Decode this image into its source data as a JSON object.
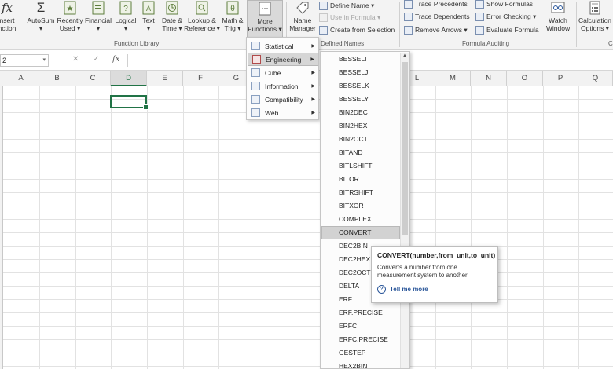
{
  "ribbon": {
    "buttons": [
      {
        "label1": "nsert",
        "label2": "nction",
        "icon": "fx-icon"
      },
      {
        "label1": "AutoSum",
        "label2": "▾",
        "icon": "sigma-icon"
      },
      {
        "label1": "Recently",
        "label2": "Used ▾",
        "icon": "star-icon"
      },
      {
        "label1": "Financial",
        "label2": "▾",
        "icon": "book-icon"
      },
      {
        "label1": "Logical",
        "label2": "▾",
        "icon": "question-book-icon"
      },
      {
        "label1": "Text",
        "label2": "▾",
        "icon": "text-book-icon"
      },
      {
        "label1": "Date &",
        "label2": "Time ▾",
        "icon": "clock-book-icon"
      },
      {
        "label1": "Lookup &",
        "label2": "Reference ▾",
        "icon": "magnifier-book-icon"
      },
      {
        "label1": "Math &",
        "label2": "Trig ▾",
        "icon": "math-book-icon"
      },
      {
        "label1": "More",
        "label2": "Functions ▾",
        "icon": "more-functions-icon"
      },
      {
        "label1": "Name",
        "label2": "Manager",
        "icon": "name-tag-icon"
      },
      {
        "label1": "Watch",
        "label2": "Window",
        "icon": "watch-window-icon"
      },
      {
        "label1": "Calculation",
        "label2": "Options ▾",
        "icon": "calculator-icon"
      }
    ],
    "defined_names": {
      "define_name": "Define Name ▾",
      "use_in_formula": "Use in Formula ▾",
      "create_from_selection": "Create from Selection"
    },
    "auditing": {
      "trace_precedents": "Trace Precedents",
      "trace_dependents": "Trace Dependents",
      "remove_arrows": "Remove Arrows ▾",
      "show_formulas": "Show Formulas",
      "error_checking": "Error Checking ▾",
      "evaluate_formula": "Evaluate Formula"
    },
    "groups": {
      "function_library": "Function Library",
      "defined_names": "Defined Names",
      "formula_auditing": "Formula Auditing",
      "calc": "C"
    }
  },
  "formula_bar": {
    "name_box": "2",
    "name_dropdown": "▾",
    "cancel": "✕",
    "enter": "✓",
    "fx": "fx"
  },
  "columns": [
    "A",
    "B",
    "C",
    "D",
    "E",
    "F",
    "G",
    "L",
    "M",
    "N",
    "O",
    "P",
    "Q"
  ],
  "more_functions_menu": [
    {
      "label": "Statistical",
      "accel": "S"
    },
    {
      "label": "Engineering",
      "accel": "E"
    },
    {
      "label": "Cube",
      "accel": "C"
    },
    {
      "label": "Information",
      "accel": "I"
    },
    {
      "label": "Compatibility",
      "accel": "C"
    },
    {
      "label": "Web",
      "accel": "W"
    }
  ],
  "engineering_functions": [
    "BESSELI",
    "BESSELJ",
    "BESSELK",
    "BESSELY",
    "BIN2DEC",
    "BIN2HEX",
    "BIN2OCT",
    "BITAND",
    "BITLSHIFT",
    "BITOR",
    "BITRSHIFT",
    "BITXOR",
    "COMPLEX",
    "CONVERT",
    "DEC2BIN",
    "DEC2HEX",
    "DEC2OCT",
    "DELTA",
    "ERF",
    "ERF.PRECISE",
    "ERFC",
    "ERFC.PRECISE",
    "GESTEP",
    "HEX2BIN"
  ],
  "tooltip": {
    "signature": "CONVERT(number,from_unit,to_unit)",
    "description": "Converts a number from one measurement system to another.",
    "help": "Tell me more"
  },
  "colors": {
    "excel_green": "#217346",
    "help_blue": "#2b579a"
  }
}
